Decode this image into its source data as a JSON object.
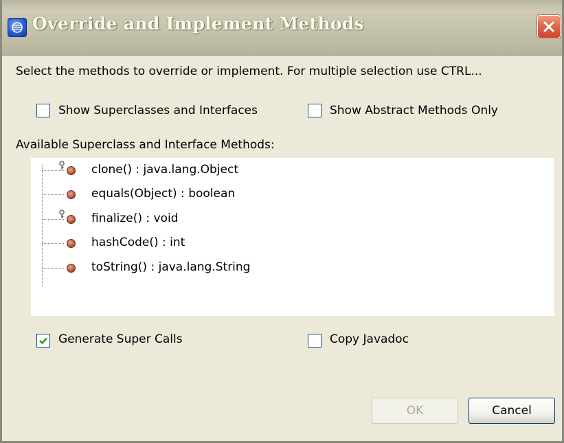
{
  "window": {
    "title": "Override and Implement Methods",
    "icon": "eclipse-app-icon",
    "close_icon": "close-icon",
    "close_color": "#e06a4c"
  },
  "instruction": "Select the methods to override or implement. For multiple selection use CTRL...",
  "filters": {
    "show_superclasses": {
      "label": "Show Superclasses and Interfaces",
      "checked": false
    },
    "show_abstract": {
      "label": "Show Abstract Methods Only",
      "checked": false
    }
  },
  "methods_caption": "Available Superclass and Interface Methods:",
  "methods": [
    {
      "label": "clone() : java.lang.Object",
      "icon": "protected-method-icon"
    },
    {
      "label": "equals(Object) : boolean",
      "icon": "public-method-icon"
    },
    {
      "label": "finalize() : void",
      "icon": "protected-method-icon"
    },
    {
      "label": "hashCode() : int",
      "icon": "public-method-icon"
    },
    {
      "label": "toString() : java.lang.String",
      "icon": "public-method-icon"
    }
  ],
  "options": {
    "generate_super_calls": {
      "label": "Generate Super Calls",
      "checked": true
    },
    "copy_javadoc": {
      "label": "Copy Javadoc",
      "checked": false
    }
  },
  "buttons": {
    "ok": {
      "label": "OK",
      "enabled": false
    },
    "cancel": {
      "label": "Cancel",
      "enabled": true
    }
  }
}
